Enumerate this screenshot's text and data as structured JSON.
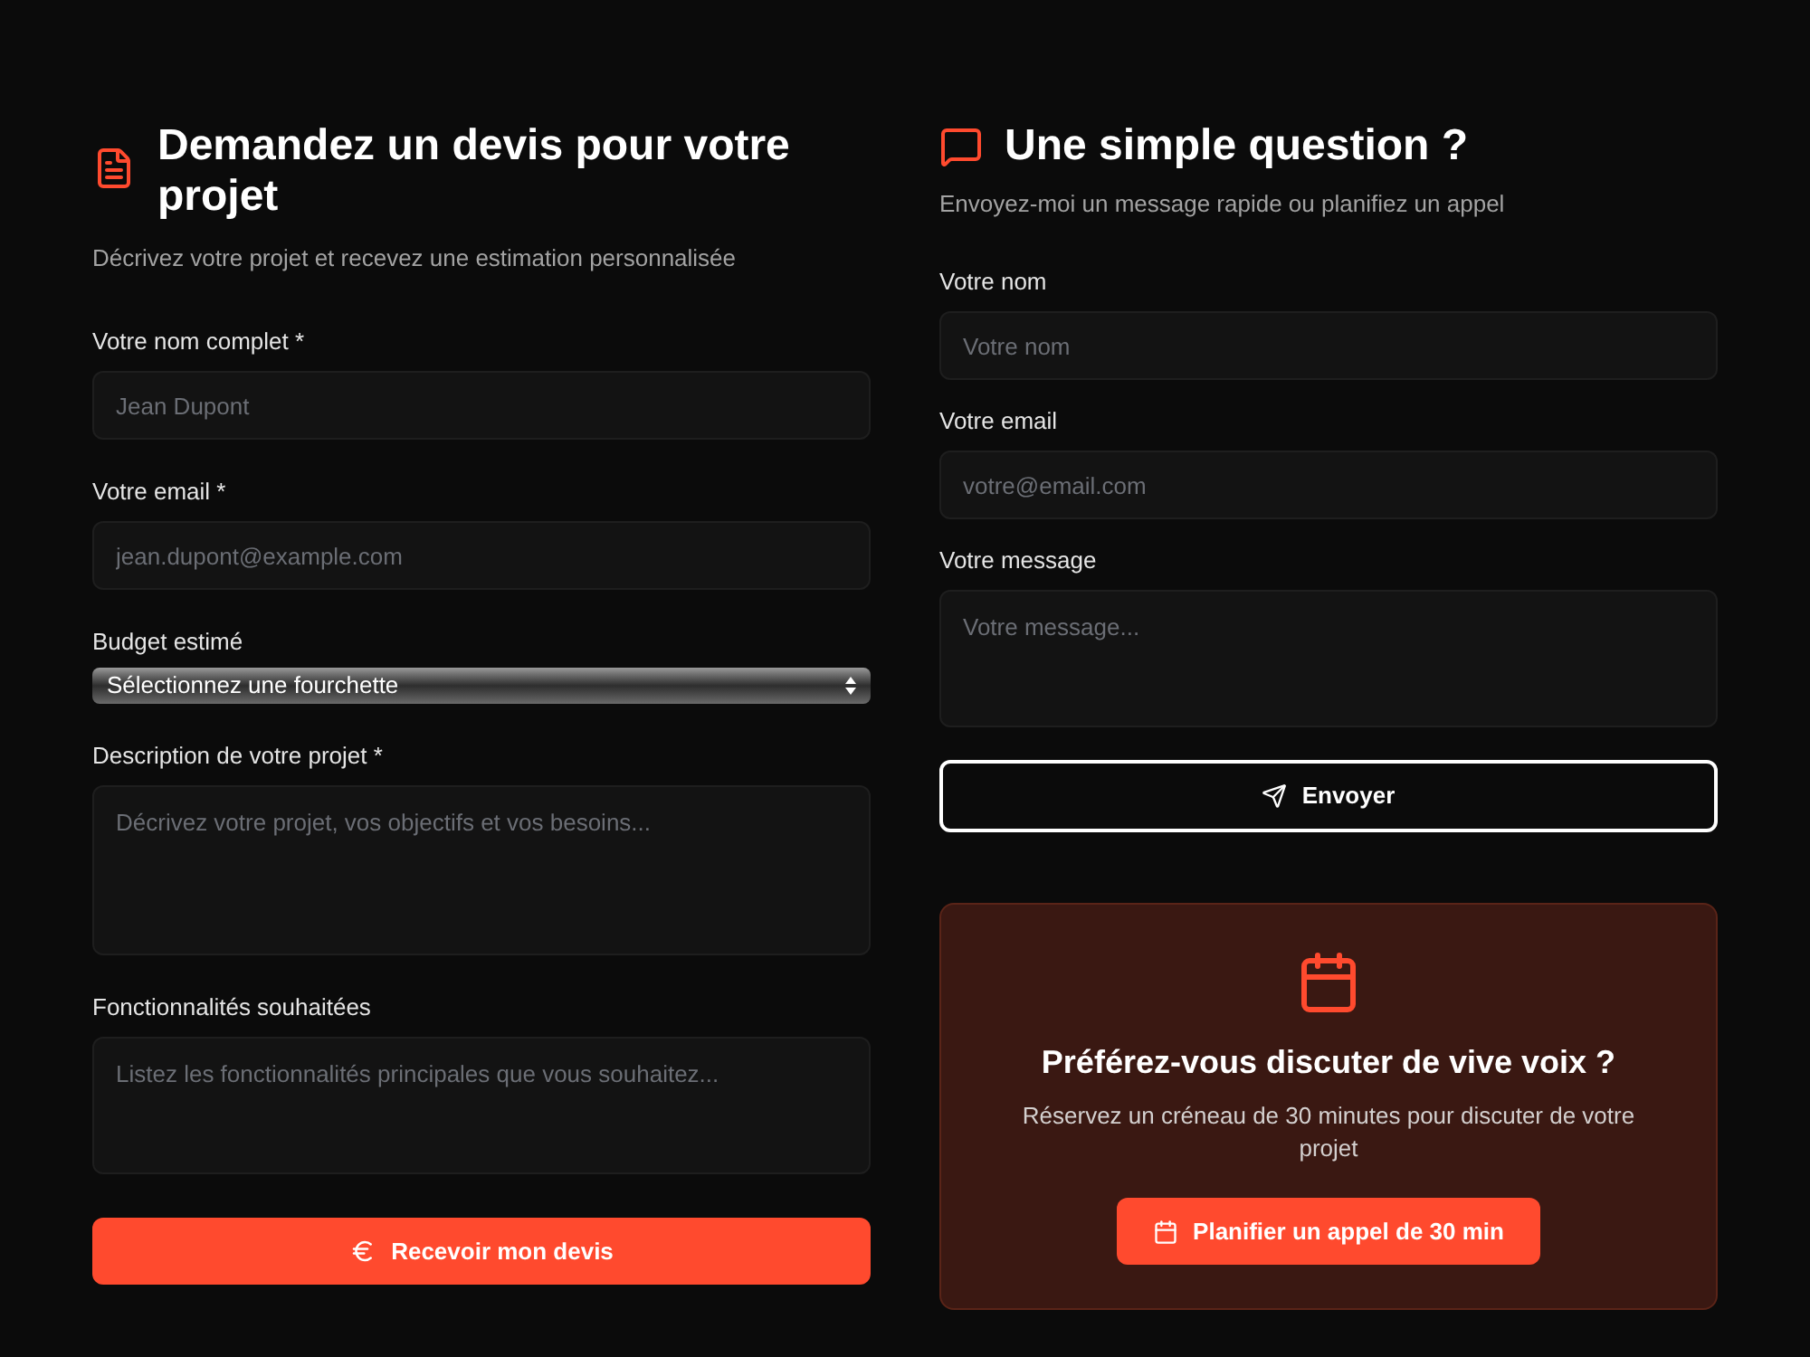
{
  "quote_form": {
    "title": "Demandez un devis pour votre projet",
    "subtitle": "Décrivez votre projet et recevez une estimation personnalisée",
    "fields": [
      {
        "kind": "input",
        "label": "Votre nom complet *",
        "placeholder": "Jean Dupont"
      },
      {
        "kind": "input",
        "label": "Votre email *",
        "placeholder": "jean.dupont@example.com"
      },
      {
        "kind": "select",
        "label": "Budget estimé",
        "value": "Sélectionnez une fourchette"
      },
      {
        "kind": "textarea",
        "label": "Description de votre projet *",
        "placeholder": "Décrivez votre projet, vos objectifs et vos besoins..."
      },
      {
        "kind": "textarea",
        "label": "Fonctionnalités souhaitées",
        "placeholder": "Listez les fonctionnalités principales que vous souhaitez..."
      }
    ],
    "submit": "Recevoir mon devis"
  },
  "question_form": {
    "title": "Une simple question ?",
    "subtitle": "Envoyez-moi un message rapide ou planifiez un appel",
    "fields": [
      {
        "kind": "input",
        "label": "Votre nom",
        "placeholder": "Votre nom"
      },
      {
        "kind": "input",
        "label": "Votre email",
        "placeholder": "votre@email.com"
      },
      {
        "kind": "textarea",
        "label": "Votre message",
        "placeholder": "Votre message..."
      }
    ],
    "submit": "Envoyer"
  },
  "call_card": {
    "title": "Préférez-vous discuter de vive voix ?",
    "text": "Réservez un créneau de 30 minutes pour discuter de votre projet",
    "button": "Planifier un appel de 30 min"
  }
}
